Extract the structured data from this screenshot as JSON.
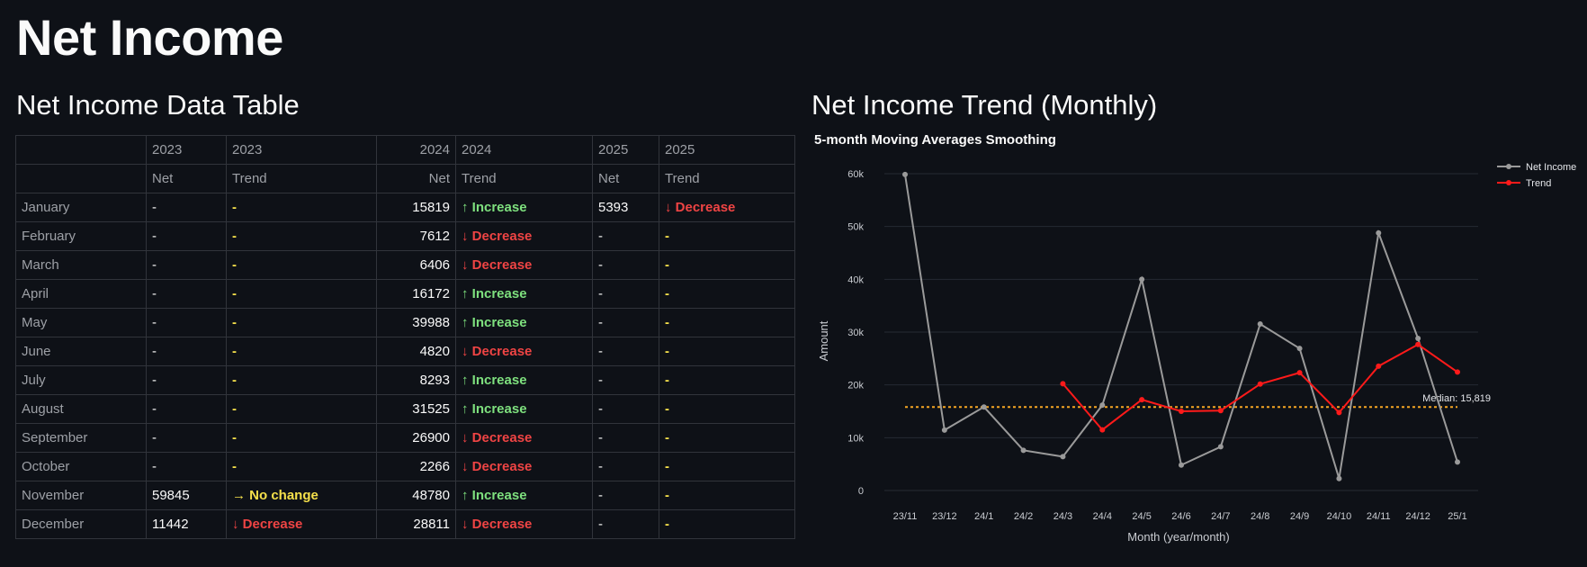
{
  "page_title": "Net Income",
  "table_section_title": "Net Income Data Table",
  "chart_section_title": "Net Income Trend (Monthly)",
  "colors": {
    "background": "#0e1117",
    "increase": "#7ee07e",
    "decrease": "#ef4444",
    "no_change": "#f5e04b",
    "net_income_line": "#9a9a9a",
    "trend_line": "#ff1a1a",
    "median_line": "#f5a623"
  },
  "table": {
    "header_years": [
      "2023",
      "2023",
      "2024",
      "2024",
      "2025",
      "2025"
    ],
    "header_metrics": [
      "Net",
      "Trend",
      "Net",
      "Trend",
      "Net",
      "Trend"
    ],
    "rows": [
      {
        "month": "January",
        "n2023": "-",
        "t2023": "-",
        "n2024": "15819",
        "t2024": "↑ Increase",
        "n2025": "5393",
        "t2025": "↓ Decrease"
      },
      {
        "month": "February",
        "n2023": "-",
        "t2023": "-",
        "n2024": "7612",
        "t2024": "↓ Decrease",
        "n2025": "-",
        "t2025": "-"
      },
      {
        "month": "March",
        "n2023": "-",
        "t2023": "-",
        "n2024": "6406",
        "t2024": "↓ Decrease",
        "n2025": "-",
        "t2025": "-"
      },
      {
        "month": "April",
        "n2023": "-",
        "t2023": "-",
        "n2024": "16172",
        "t2024": "↑ Increase",
        "n2025": "-",
        "t2025": "-"
      },
      {
        "month": "May",
        "n2023": "-",
        "t2023": "-",
        "n2024": "39988",
        "t2024": "↑ Increase",
        "n2025": "-",
        "t2025": "-"
      },
      {
        "month": "June",
        "n2023": "-",
        "t2023": "-",
        "n2024": "4820",
        "t2024": "↓ Decrease",
        "n2025": "-",
        "t2025": "-"
      },
      {
        "month": "July",
        "n2023": "-",
        "t2023": "-",
        "n2024": "8293",
        "t2024": "↑ Increase",
        "n2025": "-",
        "t2025": "-"
      },
      {
        "month": "August",
        "n2023": "-",
        "t2023": "-",
        "n2024": "31525",
        "t2024": "↑ Increase",
        "n2025": "-",
        "t2025": "-"
      },
      {
        "month": "September",
        "n2023": "-",
        "t2023": "-",
        "n2024": "26900",
        "t2024": "↓ Decrease",
        "n2025": "-",
        "t2025": "-"
      },
      {
        "month": "October",
        "n2023": "-",
        "t2023": "-",
        "n2024": "2266",
        "t2024": "↓ Decrease",
        "n2025": "-",
        "t2025": "-"
      },
      {
        "month": "November",
        "n2023": "59845",
        "t2023": "→ No change",
        "n2024": "48780",
        "t2024": "↑ Increase",
        "n2025": "-",
        "t2025": "-"
      },
      {
        "month": "December",
        "n2023": "11442",
        "t2023": "↓ Decrease",
        "n2024": "28811",
        "t2024": "↓ Decrease",
        "n2025": "-",
        "t2025": "-"
      }
    ]
  },
  "chart_data": {
    "type": "line",
    "title": "5-month Moving Averages Smoothing",
    "xlabel": "Month (year/month)",
    "ylabel": "Amount",
    "ylim": [
      0,
      60000
    ],
    "yticks": [
      0,
      10000,
      20000,
      30000,
      40000,
      50000,
      60000
    ],
    "ytick_labels": [
      "0",
      "10k",
      "20k",
      "30k",
      "40k",
      "50k",
      "60k"
    ],
    "grid": true,
    "legend_placement": "top-right",
    "categories": [
      "23/11",
      "23/12",
      "24/1",
      "24/2",
      "24/3",
      "24/4",
      "24/5",
      "24/6",
      "24/7",
      "24/8",
      "24/9",
      "24/10",
      "24/11",
      "24/12",
      "25/1"
    ],
    "series": [
      {
        "name": "Net Income",
        "color": "#9a9a9a",
        "values": [
          59845,
          11442,
          15819,
          7612,
          6406,
          16172,
          39988,
          4820,
          8293,
          31525,
          26900,
          2266,
          48780,
          28811,
          5393
        ]
      },
      {
        "name": "Trend",
        "color": "#ff1a1a",
        "values": [
          null,
          null,
          null,
          null,
          20225,
          11490,
          17199,
          14999,
          15136,
          20164,
          22305,
          14761,
          23553,
          27656,
          22430
        ]
      }
    ],
    "median": {
      "value": 15819,
      "label": "Median: 15,819"
    }
  }
}
